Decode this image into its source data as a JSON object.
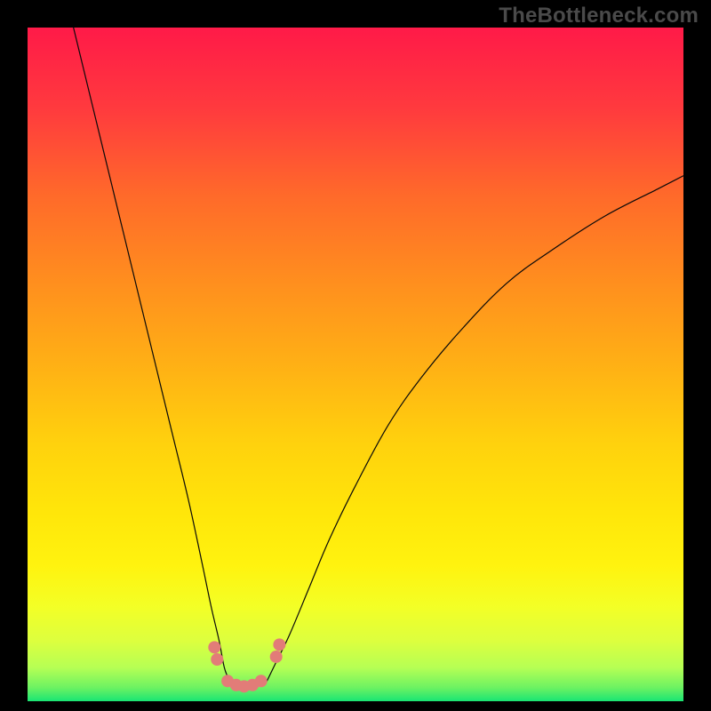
{
  "watermark": "TheBottleneck.com",
  "chart_data": {
    "type": "line",
    "title": "",
    "xlabel": "",
    "ylabel": "",
    "xlim": [
      0,
      100
    ],
    "ylim": [
      0,
      100
    ],
    "background_gradient": {
      "top_color": "#ff1a48",
      "mid_colors": [
        "#ff6a2a",
        "#ffb015",
        "#ffe60a",
        "#f3ff26",
        "#c8ff5a"
      ],
      "bottom_color": "#19e574"
    },
    "series": [
      {
        "name": "left-branch",
        "type": "line",
        "x": [
          7,
          10,
          13,
          16,
          19,
          22,
          24.5,
          26.5,
          28,
          29.2,
          30,
          30.8
        ],
        "y": [
          100,
          88,
          76,
          64,
          52,
          40,
          30,
          21,
          14,
          9,
          5,
          3
        ],
        "color": "#0a0a0a",
        "stroke_width": 1.2
      },
      {
        "name": "right-branch",
        "type": "line",
        "x": [
          36.5,
          38,
          40,
          43,
          46,
          50,
          55,
          60,
          66,
          73,
          80,
          88,
          96,
          100
        ],
        "y": [
          3,
          6,
          10,
          17,
          24,
          32,
          41,
          48,
          55,
          62,
          67,
          72,
          76,
          78
        ],
        "color": "#0a0a0a",
        "stroke_width": 1.2
      },
      {
        "name": "trough-markers",
        "type": "scatter",
        "x": [
          28.5,
          28.9,
          30.5,
          31.8,
          33.0,
          34.3,
          35.6,
          37.9,
          38.4
        ],
        "y": [
          8.0,
          6.2,
          3.0,
          2.4,
          2.2,
          2.4,
          3.0,
          6.6,
          8.4
        ],
        "color": "#e27c78",
        "marker_radius": 7
      }
    ]
  },
  "colors": {
    "black": "#000000",
    "watermark": "#4a4a4a",
    "curve": "#0a0a0a",
    "marker": "#e27c78"
  }
}
